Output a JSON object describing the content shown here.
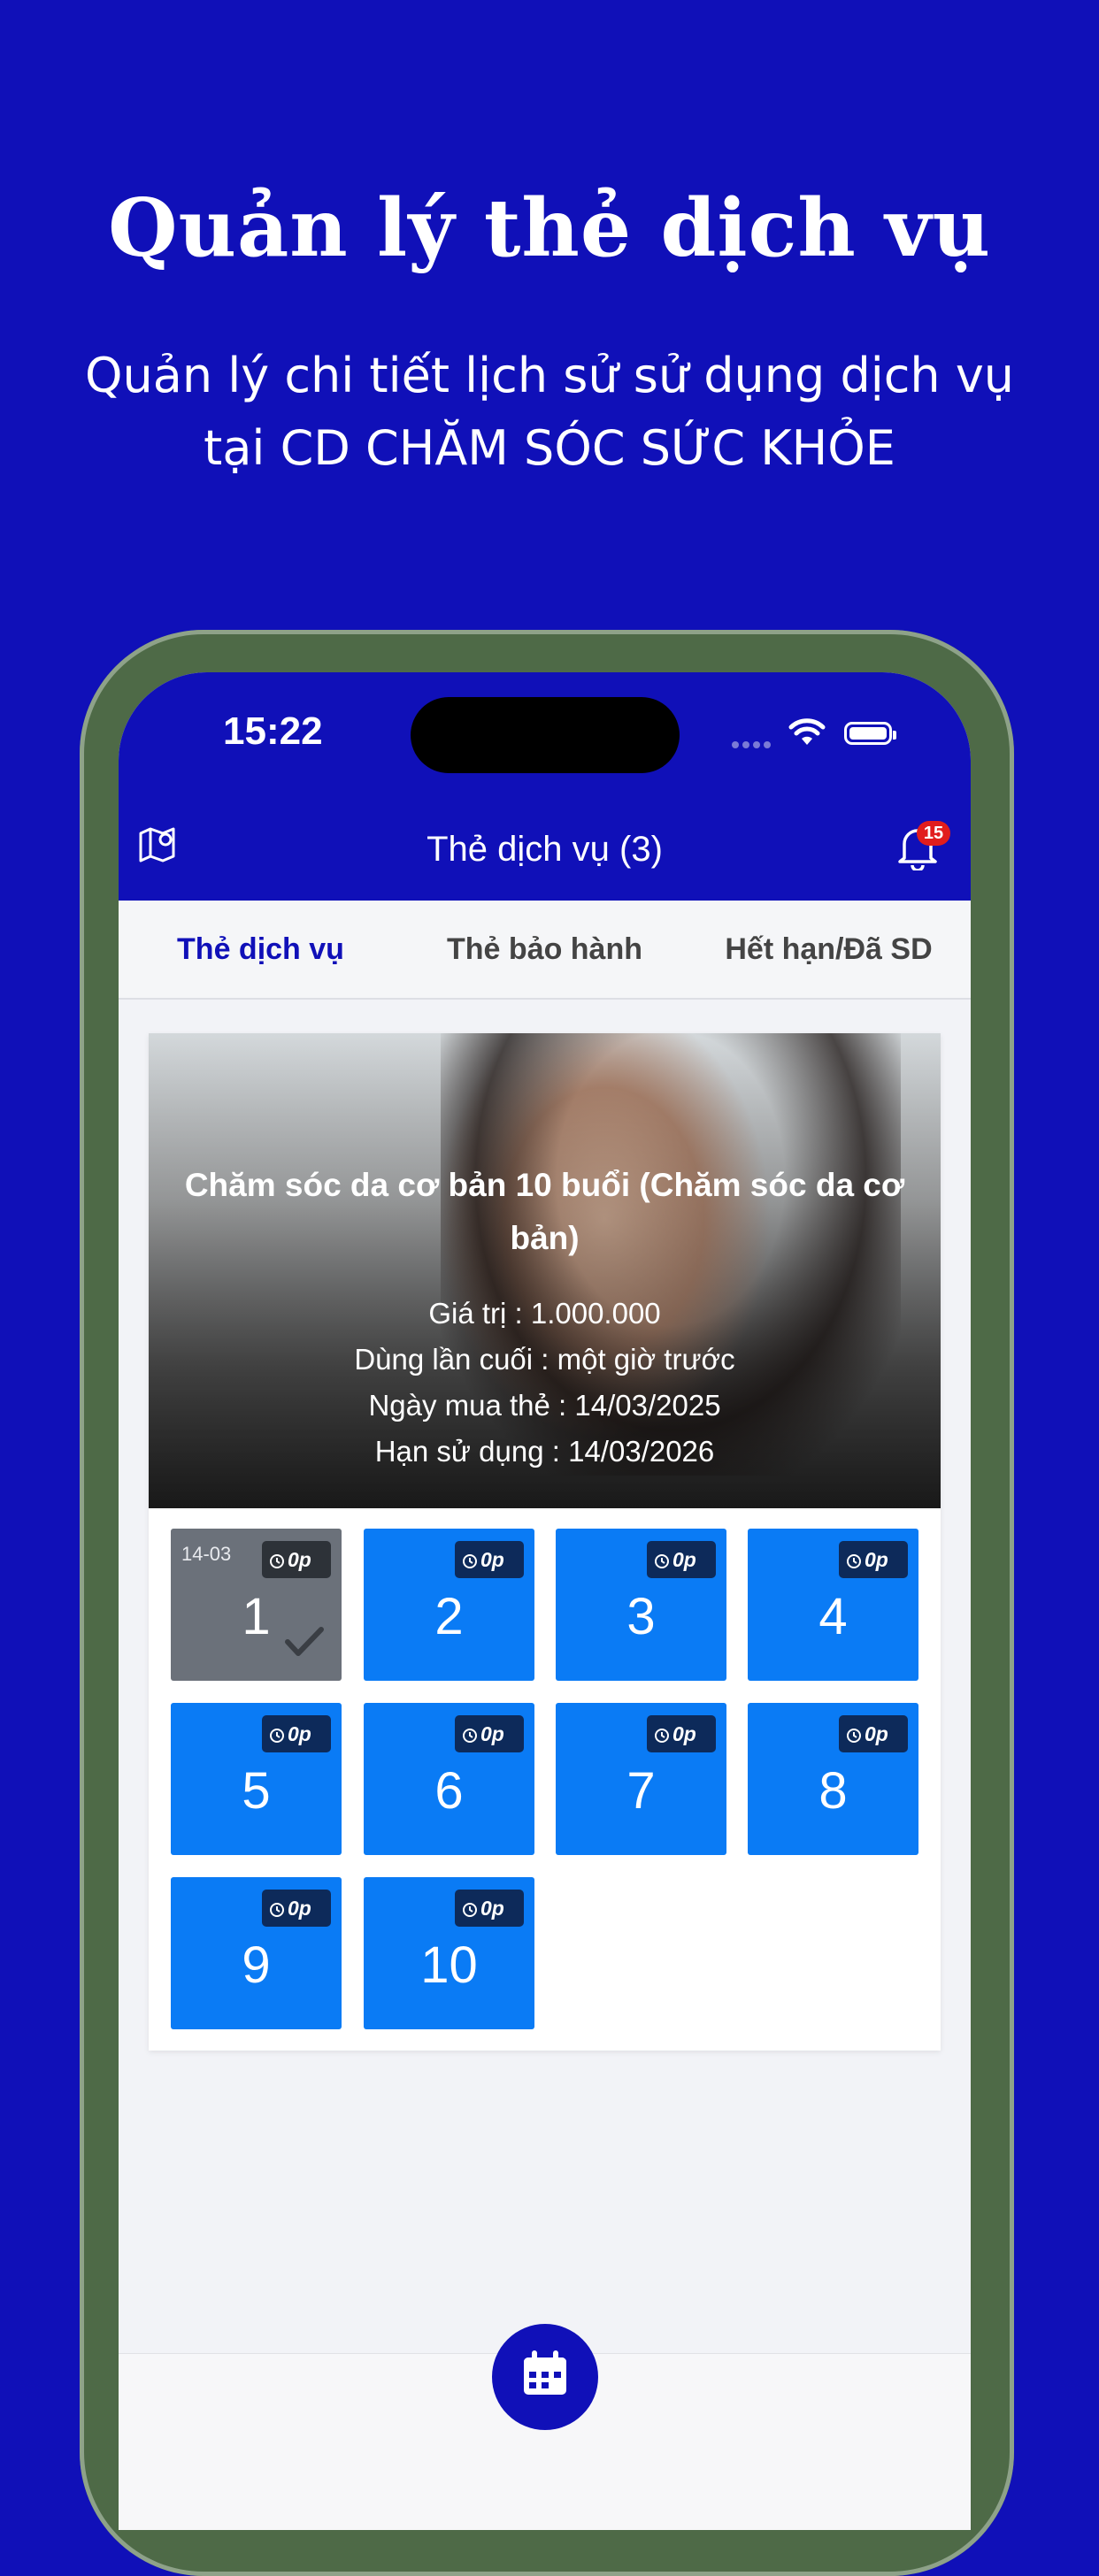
{
  "promo": {
    "title": "Quản lý thẻ dịch vụ",
    "subtitle_line1": "Quản lý chi tiết lịch sử sử dụng dịch vụ",
    "subtitle_line2": "tại CD CHĂM SÓC SỨC KHỎE"
  },
  "status_bar": {
    "time": "15:22"
  },
  "header": {
    "title": "Thẻ dịch vụ (3)",
    "notification_count": "15"
  },
  "tabs": [
    {
      "label": "Thẻ dịch vụ",
      "active": true
    },
    {
      "label": "Thẻ bảo hành",
      "active": false
    },
    {
      "label": "Hết hạn/Đã SD",
      "active": false
    }
  ],
  "card": {
    "title": "Chăm sóc da cơ bản 10 buổi (Chăm sóc da cơ bản)",
    "value": "Giá trị : 1.000.000",
    "last_used": "Dùng lần cuối : một giờ trước",
    "purchase_date": "Ngày mua thẻ : 14/03/2025",
    "expiry": "Hạn sử dụng : 14/03/2026"
  },
  "sessions": [
    {
      "number": "1",
      "duration": "0p",
      "date": "14-03",
      "used": true
    },
    {
      "number": "2",
      "duration": "0p",
      "used": false
    },
    {
      "number": "3",
      "duration": "0p",
      "used": false
    },
    {
      "number": "4",
      "duration": "0p",
      "used": false
    },
    {
      "number": "5",
      "duration": "0p",
      "used": false
    },
    {
      "number": "6",
      "duration": "0p",
      "used": false
    },
    {
      "number": "7",
      "duration": "0p",
      "used": false
    },
    {
      "number": "8",
      "duration": "0p",
      "used": false
    },
    {
      "number": "9",
      "duration": "0p",
      "used": false
    },
    {
      "number": "10",
      "duration": "0p",
      "used": false
    }
  ],
  "icons": {
    "map": "map-pin-icon",
    "bell": "bell-icon",
    "clock": "clock-icon",
    "check": "checkmark-icon",
    "calendar": "calendar-icon"
  },
  "colors": {
    "brand": "#1010b8",
    "session_active": "#0a7bf5",
    "session_used": "#6b717a",
    "badge": "#e11d1d"
  }
}
